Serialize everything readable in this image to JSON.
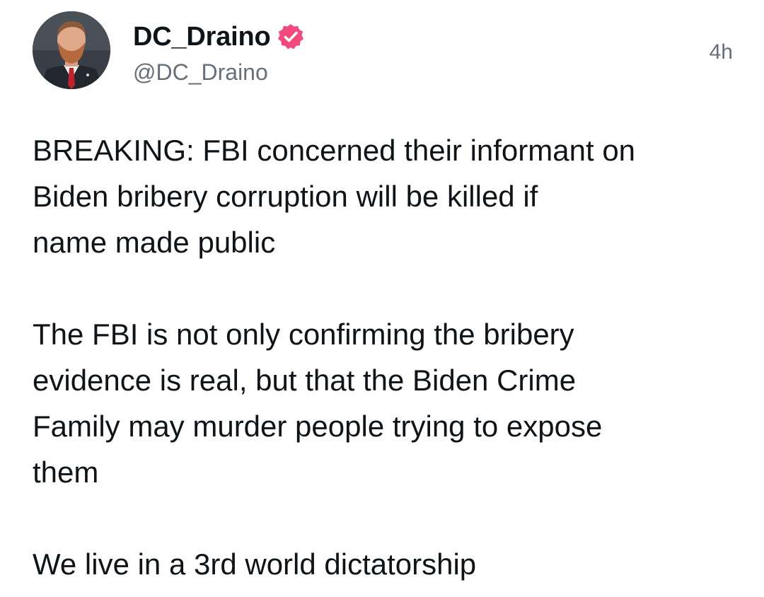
{
  "post": {
    "author": {
      "display_name": "DC_Draino",
      "handle": "@DC_Draino",
      "verified": true,
      "avatar_icon": "profile-photo"
    },
    "timestamp": "4h",
    "paragraphs": [
      "BREAKING: FBI concerned their informant on\nBiden bribery corruption will be killed if\nname made public",
      "The FBI is not only confirming the bribery\nevidence is real, but that the Biden Crime\nFamily may murder people trying to expose\nthem",
      "We live in a 3rd world dictatorship"
    ]
  },
  "colors": {
    "verified_badge": "#f4497d",
    "secondary_text": "#66707a",
    "primary_text": "#0f1419"
  }
}
